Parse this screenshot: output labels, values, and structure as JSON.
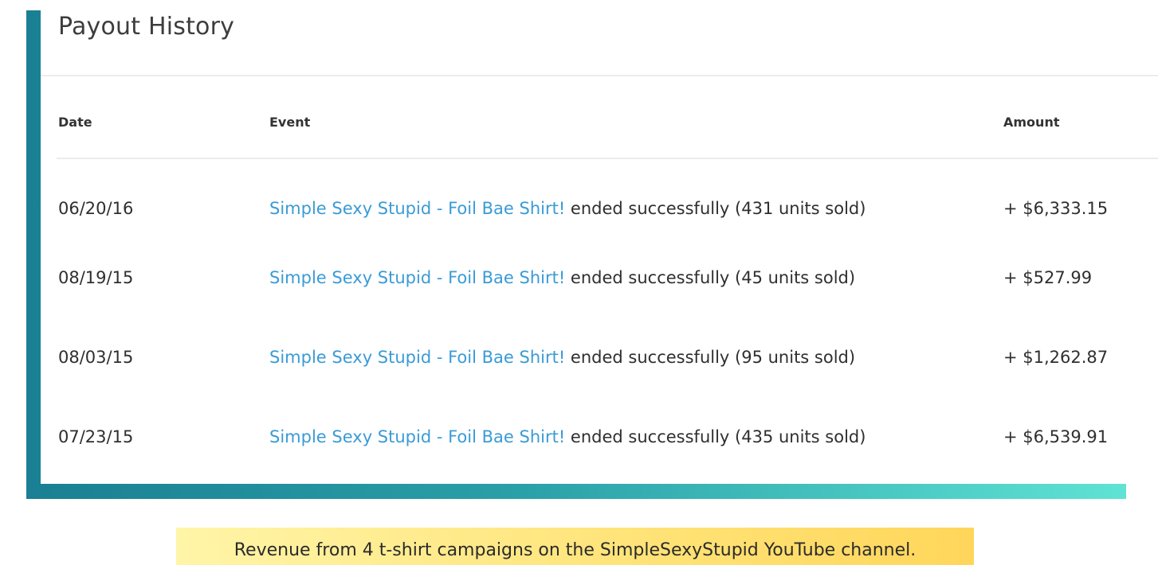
{
  "payout_history": {
    "title": "Payout History",
    "columns": {
      "date": "Date",
      "event": "Event",
      "amount": "Amount"
    },
    "rows": [
      {
        "date": "06/20/16",
        "event_link": "Simple Sexy Stupid - Foil Bae Shirt!",
        "event_suffix": " ended successfully (431 units sold)",
        "amount": "+ $6,333.15"
      },
      {
        "date": "08/19/15",
        "event_link": "Simple Sexy Stupid - Foil Bae Shirt!",
        "event_suffix": " ended successfully (45 units sold)",
        "amount": "+ $527.99"
      },
      {
        "date": "08/03/15",
        "event_link": "Simple Sexy Stupid - Foil Bae Shirt!",
        "event_suffix": " ended successfully (95 units sold)",
        "amount": "+ $1,262.87"
      },
      {
        "date": "07/23/15",
        "event_link": "Simple Sexy Stupid - Foil Bae Shirt!",
        "event_suffix": " ended successfully (435 units sold)",
        "amount": "+ $6,539.91"
      }
    ]
  },
  "caption": {
    "text": "Revenue from 4 t-shirt campaigns on the SimpleSexyStupid YouTube channel."
  },
  "colors": {
    "link": "#3a9bd6",
    "frame_start": "#1a7f93",
    "frame_end": "#5fe3d4",
    "caption_bg": "#ffe47a"
  }
}
